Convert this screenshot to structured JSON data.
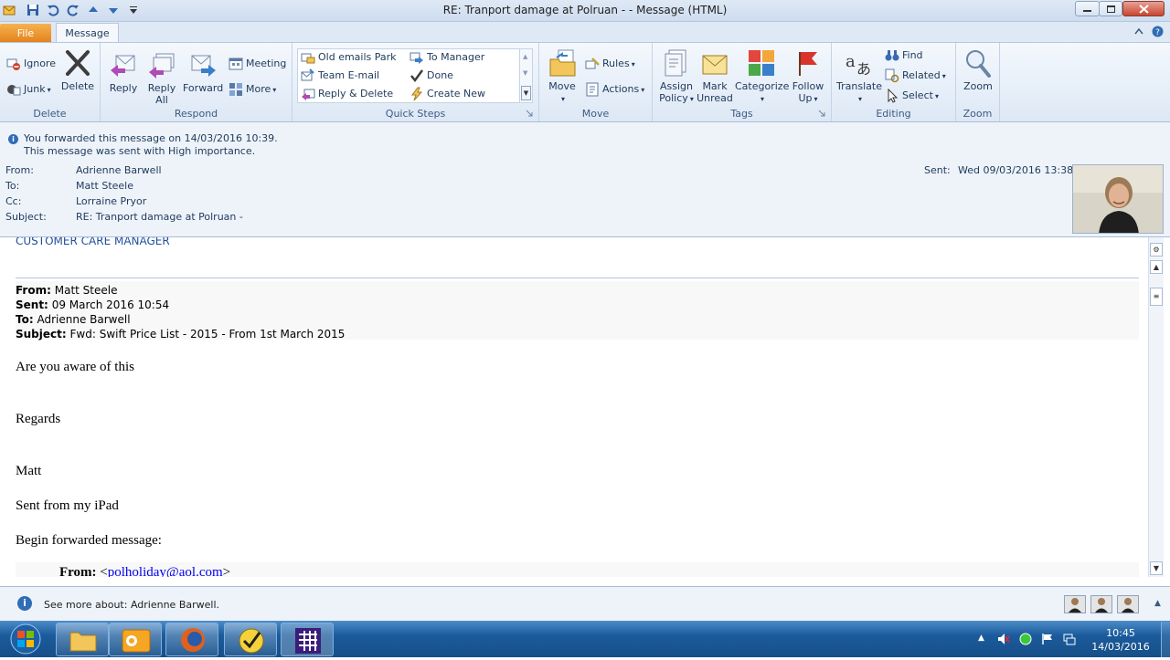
{
  "window": {
    "title": "RE: Tranport damage at Polruan -  - Message (HTML)"
  },
  "tabs": {
    "file": "File",
    "message": "Message"
  },
  "ribbon": {
    "delete_group": {
      "label": "Delete",
      "ignore": "Ignore",
      "junk": "Junk",
      "delete": "Delete"
    },
    "respond_group": {
      "label": "Respond",
      "reply": "Reply",
      "reply_all_1": "Reply",
      "reply_all_2": "All",
      "forward": "Forward",
      "meeting": "Meeting",
      "more": "More"
    },
    "quicksteps_group": {
      "label": "Quick Steps",
      "items": [
        "Old emails Park",
        "To Manager",
        "Team E-mail",
        "Done",
        "Reply & Delete",
        "Create New"
      ]
    },
    "move_group": {
      "label": "Move",
      "move": "Move",
      "rules": "Rules",
      "actions": "Actions"
    },
    "tags_group": {
      "label": "Tags",
      "assign_policy_1": "Assign",
      "assign_policy_2": "Policy",
      "mark_unread_1": "Mark",
      "mark_unread_2": "Unread",
      "categorize": "Categorize",
      "follow_up_1": "Follow",
      "follow_up_2": "Up"
    },
    "editing_group": {
      "label": "Editing",
      "translate": "Translate",
      "find": "Find",
      "related": "Related",
      "select": "Select"
    },
    "zoom_group": {
      "label": "Zoom",
      "zoom": "Zoom"
    }
  },
  "infobar": {
    "line1": "You forwarded this message on 14/03/2016 10:39.",
    "line2": "This message was sent with High importance."
  },
  "header": {
    "from_label": "From:",
    "from": "Adrienne Barwell",
    "to_label": "To:",
    "to": "Matt Steele",
    "cc_label": "Cc:",
    "cc": "Lorraine Pryor",
    "subject_label": "Subject:",
    "subject": "RE: Tranport damage at Polruan -",
    "sent_label": "Sent:",
    "sent": "Wed 09/03/2016 13:38"
  },
  "body": {
    "signature_title": "CUSTOMER CARE MANAGER",
    "fwd_from_label": "From:",
    "fwd_from": "Matt Steele",
    "fwd_sent_label": "Sent:",
    "fwd_sent": "09 March 2016 10:54",
    "fwd_to_label": "To:",
    "fwd_to": "Adrienne Barwell",
    "fwd_subject_label": "Subject:",
    "fwd_subject": "Fwd: Swift Price List - 2015 - From 1st March 2015",
    "p1": "Are you aware of this",
    "p2": "Regards",
    "p3": "Matt",
    "p4": "Sent from my iPad",
    "p5": "Begin forwarded message:",
    "inner_from_label": "From:",
    "inner_from_open": "<",
    "inner_from_email": "polholiday@aol.com",
    "inner_from_close": ">"
  },
  "people_pane": {
    "text": "See more about: Adrienne Barwell."
  },
  "taskbar": {
    "time": "10:45",
    "date": "14/03/2016"
  },
  "colors": {
    "ribbon_text": "#1e395b",
    "file_tab": "#e4801b",
    "link": "#0000ee",
    "taskbar": "#1b5b9c"
  }
}
